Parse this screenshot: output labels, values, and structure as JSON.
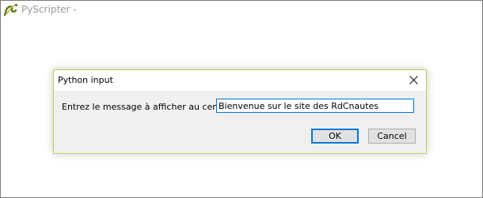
{
  "main_window": {
    "title": "PyScripter -",
    "icon": "pyscripter-snake-icon"
  },
  "dialog": {
    "title": "Python input",
    "close_icon": "close-icon",
    "prompt_label": "Entrez le message à afficher au centre:",
    "input_value": "Bienvenue sur le site des RdCnautes",
    "ok_label": "OK",
    "cancel_label": "Cancel"
  },
  "colors": {
    "dialog_border": "#b9d25f",
    "input_focus_border": "#0078d7",
    "dialog_background": "#f0f0f0",
    "main_title_text": "#999999"
  }
}
